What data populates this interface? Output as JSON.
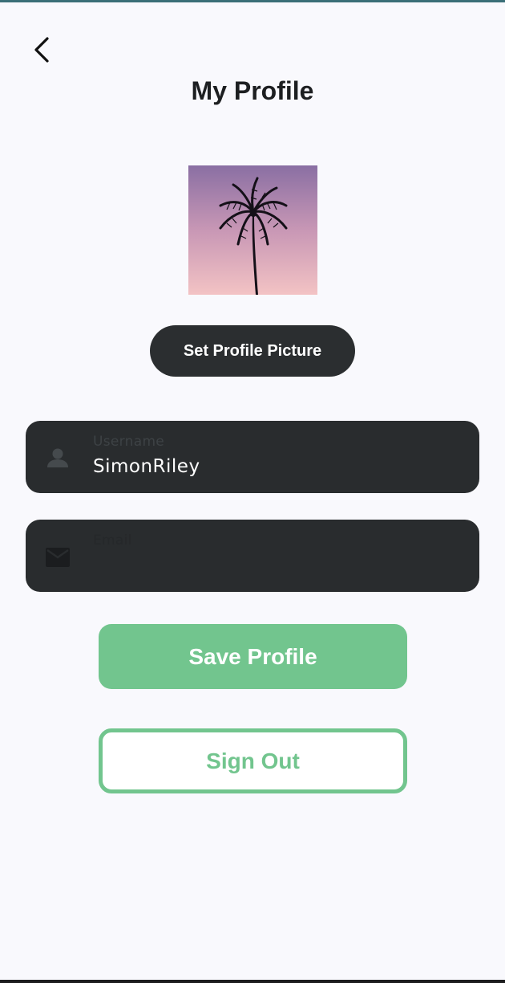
{
  "header": {
    "back_icon": "chevron-left-icon",
    "title": "My Profile"
  },
  "profile_picture": {
    "description_icon": "palm-tree-image"
  },
  "buttons": {
    "set_picture_label": "Set Profile Picture",
    "save_label": "Save Profile",
    "sign_out_label": "Sign Out"
  },
  "fields": {
    "username": {
      "icon": "person-icon",
      "label": "Username",
      "value": "SimonRiley"
    },
    "email": {
      "icon": "envelope-icon",
      "label": "Email",
      "value": ""
    }
  },
  "colors": {
    "accent": "#72c58e",
    "dark_surface": "#292c2e",
    "background": "#f9f9fd"
  }
}
